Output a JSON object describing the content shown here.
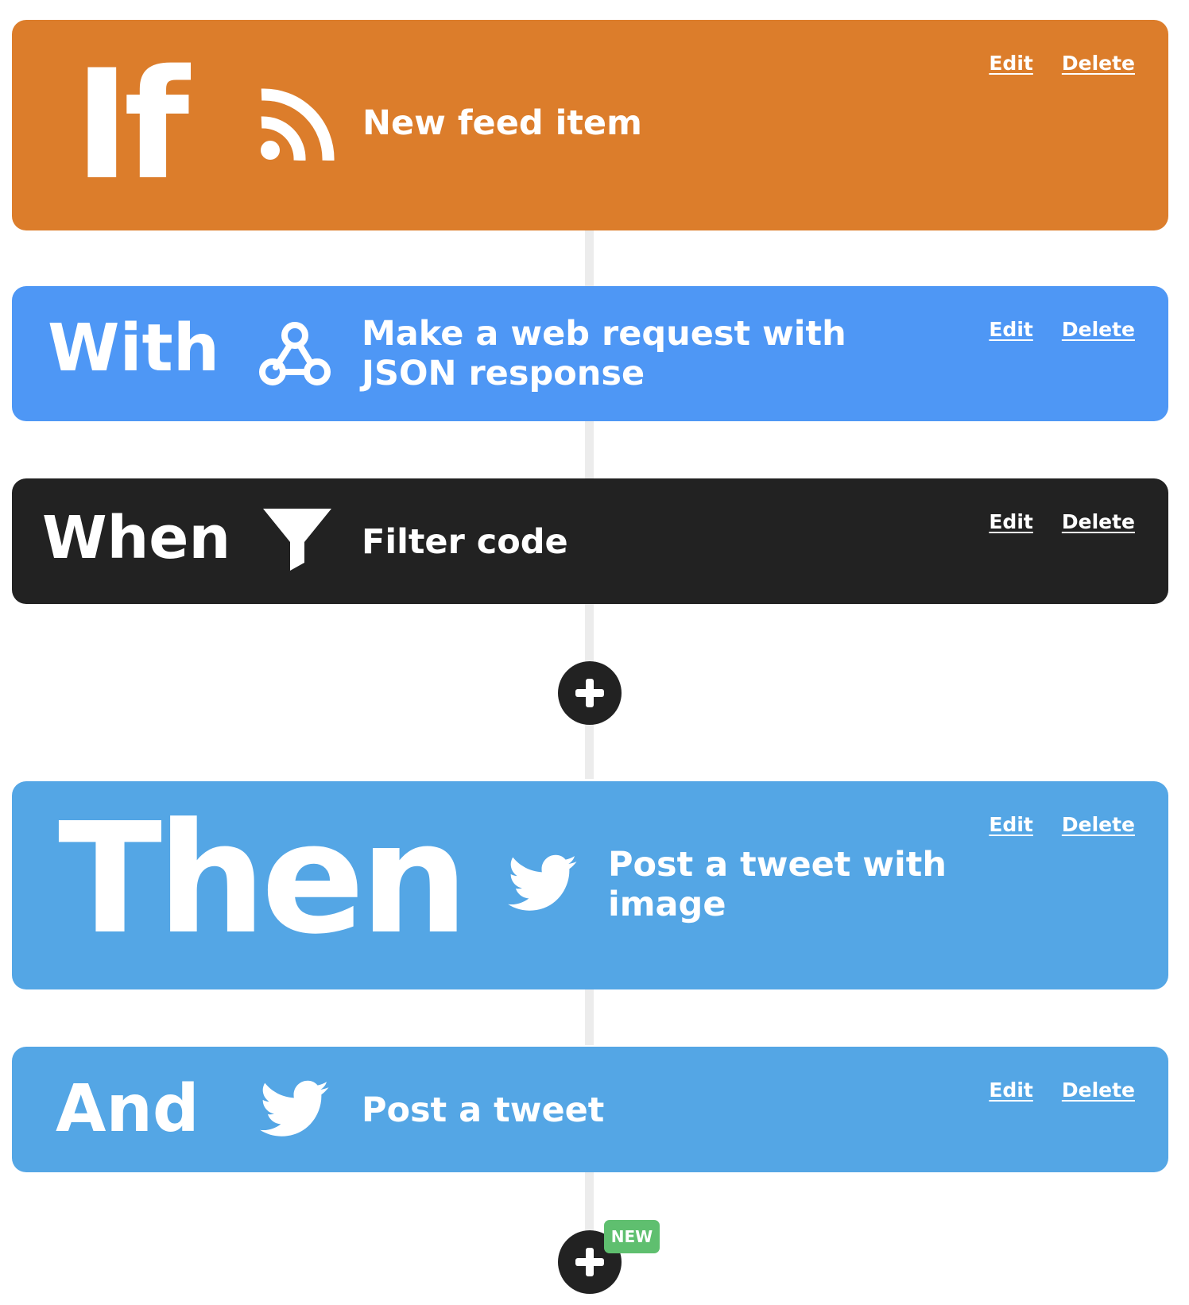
{
  "colors": {
    "if_card": "#dc7d2b",
    "with_card": "#4e97f5",
    "when_card": "#222222",
    "then_card": "#54a6e5",
    "and_card": "#54a6e5",
    "connector": "#ececec",
    "add_button": "#222222",
    "new_badge": "#5fbf6f"
  },
  "steps": [
    {
      "keyword": "If",
      "icon": "rss-icon",
      "action": "New feed item",
      "edit_label": "Edit",
      "delete_label": "Delete"
    },
    {
      "keyword": "With",
      "icon": "webhook-icon",
      "action": "Make a web request with JSON response",
      "edit_label": "Edit",
      "delete_label": "Delete"
    },
    {
      "keyword": "When",
      "icon": "filter-icon",
      "action": "Filter code",
      "edit_label": "Edit",
      "delete_label": "Delete"
    },
    {
      "keyword": "Then",
      "icon": "twitter-icon",
      "action": "Post a tweet with image",
      "edit_label": "Edit",
      "delete_label": "Delete"
    },
    {
      "keyword": "And",
      "icon": "twitter-icon",
      "action": "Post a tweet",
      "edit_label": "Edit",
      "delete_label": "Delete"
    }
  ],
  "add_buttons": [
    {
      "icon": "plus-icon"
    },
    {
      "icon": "plus-icon",
      "badge": "NEW"
    }
  ]
}
